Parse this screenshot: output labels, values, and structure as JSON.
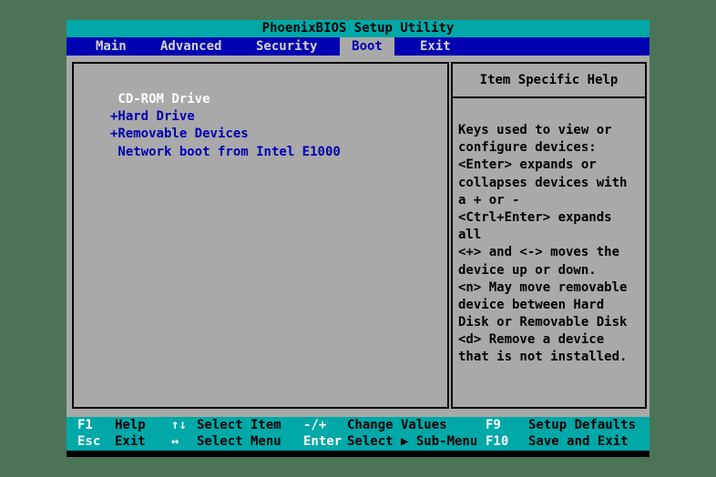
{
  "window": {
    "title": "PhoenixBIOS Setup Utility"
  },
  "menu": {
    "items": [
      {
        "label": "Main",
        "active": false
      },
      {
        "label": "Advanced",
        "active": false
      },
      {
        "label": "Security",
        "active": false
      },
      {
        "label": "Boot",
        "active": true
      },
      {
        "label": "Exit",
        "active": false
      }
    ]
  },
  "boot_menu": {
    "items": [
      {
        "prefix": "",
        "label": "CD-ROM Drive",
        "selected": true
      },
      {
        "prefix": "+",
        "label": "Hard Drive",
        "selected": false
      },
      {
        "prefix": "+",
        "label": "Removable Devices",
        "selected": false
      },
      {
        "prefix": "",
        "label": "Network boot from Intel E1000",
        "selected": false
      }
    ]
  },
  "help_panel": {
    "title": "Item Specific Help",
    "lines": [
      "Keys used to view or",
      "configure devices:",
      "<Enter> expands or",
      "collapses devices with",
      "a + or -",
      "<Ctrl+Enter> expands",
      "all",
      "<+> and <-> moves the",
      "device up or down.",
      "<n> May move removable",
      "device between Hard",
      "Disk or Removable Disk",
      "<d> Remove a device",
      "that is not installed."
    ]
  },
  "key_legend": {
    "rows": [
      {
        "keys": [
          {
            "key": "F1",
            "action": "Help"
          },
          {
            "key": "↑↓",
            "action": "Select Item"
          },
          {
            "key": "-/+",
            "action": "Change Values"
          },
          {
            "key": "F9",
            "action": "Setup Defaults"
          }
        ]
      },
      {
        "keys": [
          {
            "key": "Esc",
            "action": "Exit"
          },
          {
            "key": "↔",
            "action": "Select Menu"
          },
          {
            "key": "Enter",
            "action": "Select ▶ Sub-Menu"
          },
          {
            "key": "F10",
            "action": "Save and Exit"
          }
        ]
      }
    ]
  },
  "colors": {
    "console_background": "#4b7456",
    "teal": "#00a8a8",
    "blue": "#0000b3",
    "gray": "#a9a9a9",
    "item_text": "#0000b3",
    "selected_item_text": "#ffffff",
    "tab_text": "#d4d4d4"
  }
}
